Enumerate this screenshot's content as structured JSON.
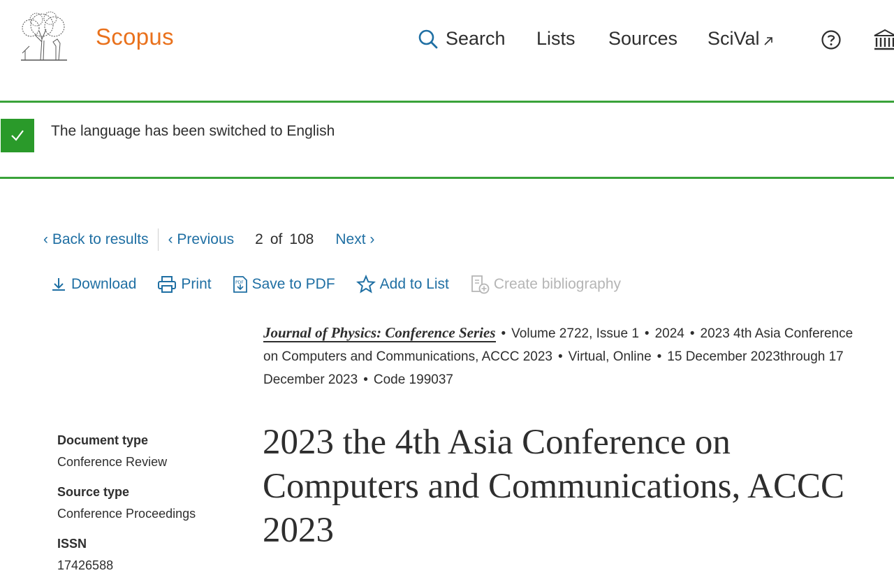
{
  "header": {
    "brand": "Scopus",
    "nav": {
      "search": "Search",
      "lists": "Lists",
      "sources": "Sources",
      "scival": "SciVal"
    },
    "icons": [
      "elsevier-tree-logo",
      "search-icon",
      "external-link-icon",
      "help-icon",
      "institution-icon"
    ]
  },
  "alert": {
    "message": "The language has been switched to English",
    "color": "#2a9a2a"
  },
  "result_nav": {
    "back": "Back to results",
    "previous": "Previous",
    "current": "2",
    "of": "of",
    "total": "108",
    "next": "Next"
  },
  "toolbar": {
    "download": "Download",
    "print": "Print",
    "save_pdf": "Save to PDF",
    "add_to_list": "Add to List",
    "create_bibliography": "Create bibliography"
  },
  "source": {
    "journal": "Journal of Physics: Conference Series",
    "volume": "Volume 2722, Issue 1",
    "year": "2024",
    "conference": "2023 4th Asia Conference on Computers and Communications, ACCC 2023",
    "location": "Virtual, Online",
    "dates": "15 December 2023through 17 December 2023",
    "code": "Code 199037"
  },
  "meta": {
    "doc_type_label": "Document type",
    "doc_type_value": "Conference Review",
    "source_type_label": "Source type",
    "source_type_value": "Conference Proceedings",
    "issn_label": "ISSN",
    "issn_value": "17426588"
  },
  "title": "2023 the 4th Asia Conference on Computers and Communications, ACCC 2023",
  "colors": {
    "brand": "#e9711c",
    "link": "#1f6fa3",
    "success": "#3aa33a"
  }
}
